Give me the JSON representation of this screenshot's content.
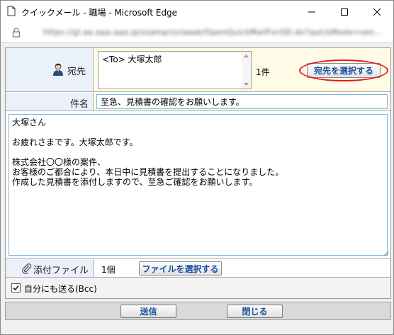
{
  "window": {
    "title": "クイックメール - 職場 - Microsoft Edge",
    "url": "https://gl.aa.aaa.aaa.jp/ssamp/ss/aaab/OpenQuickMailForGD.do?quickMode=sen..."
  },
  "to_row": {
    "label": "宛先",
    "recipient": "<To> 大塚太郎",
    "count": "1件",
    "select_button": "宛先を選択する"
  },
  "subject_row": {
    "label": "件名",
    "value": "至急、見積書の確認をお願いします。"
  },
  "body": {
    "text": "大塚さん\n\nお疲れさまです。大塚太郎です。\n\n株式会社〇〇様の案件、\nお客様のご都合により、本日中に見積書を提出することになりました。\n作成した見積書を添付しますので、至急ご確認をお願いします。"
  },
  "attach_row": {
    "label": "添付ファイル",
    "count": "1個",
    "select_button": "ファイルを選択する"
  },
  "bcc": {
    "label": "自分にも送る(Bcc)",
    "checked": true
  },
  "footer": {
    "send_label": "送信",
    "close_label": "閉じる"
  },
  "colors": {
    "label_bg": "#eaf1fa",
    "value_bg": "#fffbe6",
    "button_text": "#1a4fa0",
    "highlight_ellipse": "#e02020"
  }
}
